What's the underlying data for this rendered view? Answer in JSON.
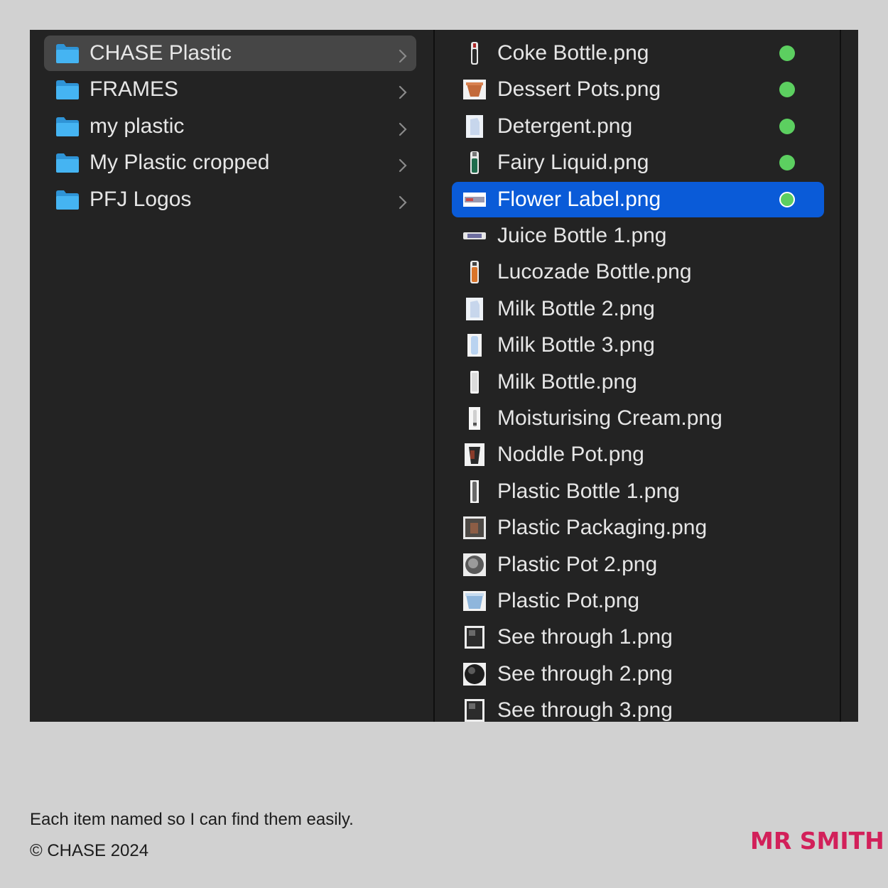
{
  "folders": [
    {
      "label": "CHASE Plastic",
      "selected": true
    },
    {
      "label": "FRAMES",
      "selected": false
    },
    {
      "label": "my plastic",
      "selected": false
    },
    {
      "label": "My Plastic cropped",
      "selected": false
    },
    {
      "label": "PFJ Logos",
      "selected": false
    }
  ],
  "files": [
    {
      "label": "Coke Bottle.png",
      "tag": "green",
      "thumb": "bottle-dark"
    },
    {
      "label": "Dessert Pots.png",
      "tag": "green",
      "thumb": "pot-orange"
    },
    {
      "label": "Detergent.png",
      "tag": "green",
      "thumb": "jug-light"
    },
    {
      "label": "Fairy Liquid.png",
      "tag": "green",
      "thumb": "bottle-green"
    },
    {
      "label": "Flower Label.png",
      "tag": "green",
      "thumb": "label-strip",
      "selected": true
    },
    {
      "label": "Juice Bottle 1.png",
      "tag": "",
      "thumb": "flat-strip"
    },
    {
      "label": "Lucozade Bottle.png",
      "tag": "",
      "thumb": "bottle-orange"
    },
    {
      "label": "Milk Bottle 2.png",
      "tag": "",
      "thumb": "jug-light"
    },
    {
      "label": "Milk Bottle 3.png",
      "tag": "",
      "thumb": "jug-blue"
    },
    {
      "label": "Milk Bottle.png",
      "tag": "",
      "thumb": "bottle-white"
    },
    {
      "label": "Moisturising Cream.png",
      "tag": "",
      "thumb": "tube-white"
    },
    {
      "label": "Noddle Pot.png",
      "tag": "",
      "thumb": "cup-dark"
    },
    {
      "label": "Plastic Bottle 1.png",
      "tag": "",
      "thumb": "bottle-grey"
    },
    {
      "label": "Plastic Packaging.png",
      "tag": "",
      "thumb": "square-brown"
    },
    {
      "label": "Plastic Pot 2.png",
      "tag": "",
      "thumb": "round-grey"
    },
    {
      "label": "Plastic Pot.png",
      "tag": "",
      "thumb": "pot-blue"
    },
    {
      "label": "See through 1.png",
      "tag": "",
      "thumb": "square-dark"
    },
    {
      "label": "See through 2.png",
      "tag": "",
      "thumb": "round-dark"
    },
    {
      "label": "See through 3.png",
      "tag": "",
      "thumb": "square-dark"
    }
  ],
  "colors": {
    "selection": "#0a5bd8",
    "tag_green": "#5ccf60",
    "folder_blue": "#3aa8ee",
    "brand": "#d2205a"
  },
  "icons": {
    "folder": "folder-icon",
    "chevron": "chevron-right-icon",
    "tag": "green-tag-icon"
  },
  "footer": {
    "caption": "Each item named so I can find them easily.",
    "copyright": "© CHASE 2024",
    "brand": "MR SMITH"
  }
}
